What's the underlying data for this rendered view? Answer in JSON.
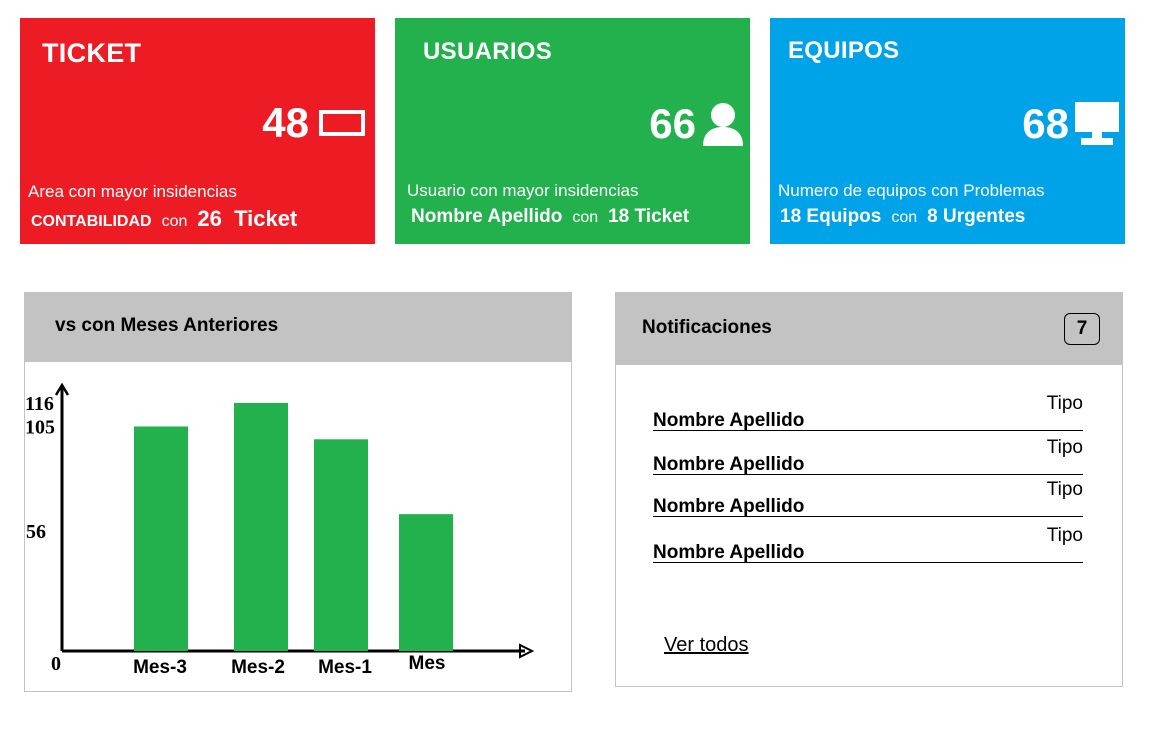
{
  "cards": [
    {
      "title": "TICKET",
      "value": "48",
      "icon": "ticket-icon",
      "color": "#ed1c24",
      "description": "Area con mayor insidencias",
      "footer_highlight": "CONTABILIDAD",
      "footer_connector": "con",
      "footer_value": "26  Ticket"
    },
    {
      "title": "USUARIOS",
      "value": "66",
      "icon": "user-icon",
      "color": "#22b14c",
      "description": "Usuario con mayor insidencias",
      "footer_highlight": "Nombre Apellido",
      "footer_connector": "con",
      "footer_value": "18 Ticket"
    },
    {
      "title": "EQUIPOS",
      "value": "68",
      "icon": "monitor-icon",
      "color": "#00a2e8",
      "description": "Numero de equipos con Problemas",
      "footer_highlight": "18 Equipos",
      "footer_connector": "con",
      "footer_value": "8 Urgentes"
    }
  ],
  "chart_panel": {
    "title": "vs con Meses Anteriores"
  },
  "chart_data": {
    "type": "bar",
    "title": "vs con Meses Anteriores",
    "categories": [
      "Mes-3",
      "Mes-2",
      "Mes-1",
      "Mes"
    ],
    "values": [
      105,
      116,
      99,
      64
    ],
    "y_tick_labels": [
      "0",
      "56",
      "105",
      "116"
    ],
    "ylim": [
      0,
      130
    ],
    "bar_color": "#22b14c",
    "grid": false,
    "legend": "none"
  },
  "notifications": {
    "title": "Notificaciones",
    "count": "7",
    "items": [
      {
        "name": "Nombre Apellido",
        "type": "Tipo"
      },
      {
        "name": "Nombre Apellido",
        "type": "Tipo"
      },
      {
        "name": "Nombre Apellido",
        "type": "Tipo"
      },
      {
        "name": "Nombre Apellido",
        "type": "Tipo"
      }
    ],
    "view_all_label": "Ver todos"
  }
}
